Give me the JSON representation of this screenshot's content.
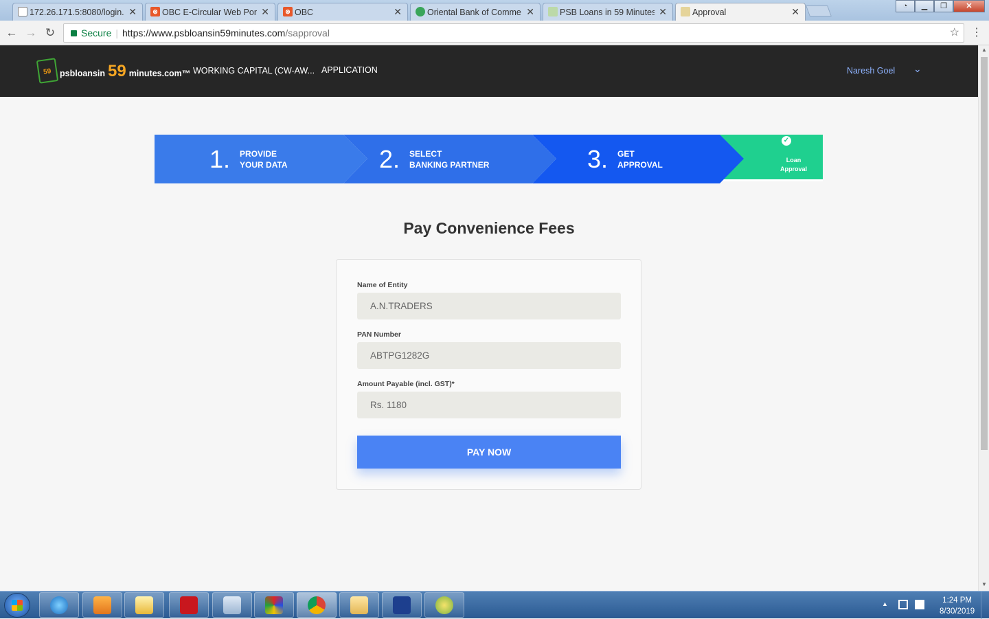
{
  "browser": {
    "tabs": [
      {
        "label": "172.26.171.5:8080/login.",
        "icon": "page-icon",
        "active": false
      },
      {
        "label": "OBC E-Circular Web Port",
        "icon": "obc-icon",
        "active": false
      },
      {
        "label": "OBC",
        "icon": "obc-icon",
        "active": false
      },
      {
        "label": "Oriental Bank of Comme",
        "icon": "obc-bank-icon",
        "active": false
      },
      {
        "label": "PSB Loans in 59 Minutes",
        "icon": "psb-icon",
        "active": false
      },
      {
        "label": "Approval",
        "icon": "psb-icon",
        "active": true
      }
    ],
    "close_glyph": "✕",
    "secure_label": "Secure",
    "url_host": "https://www.psbloansin59minutes.com",
    "url_path": "/sapproval"
  },
  "header": {
    "logo_prefix": "psbloansin",
    "logo_number": "59",
    "logo_suffix": "minutes.com™",
    "logo_badge": "59",
    "product": "WORKING CAPITAL (CW-AW...",
    "nav_application": "APPLICATION",
    "user_name": "Naresh Goel"
  },
  "steps": [
    {
      "number": "1.",
      "line1": "PROVIDE",
      "line2": "YOUR DATA"
    },
    {
      "number": "2.",
      "line1": "SELECT",
      "line2": "BANKING PARTNER"
    },
    {
      "number": "3.",
      "line1": "GET",
      "line2": "APPROVAL"
    },
    {
      "line1": "Loan",
      "line2": "Approval",
      "status": "complete"
    }
  ],
  "form": {
    "title": "Pay Convenience Fees",
    "entity_label": "Name of Entity",
    "entity_value": "A.N.TRADERS",
    "pan_label": "PAN Number",
    "pan_value": "ABTPG1282G",
    "amount_label": "Amount Payable (incl. GST)*",
    "amount_value": "Rs. 1180",
    "pay_button": "PAY NOW"
  },
  "taskbar": {
    "time": "1:24 PM",
    "date": "8/30/2019",
    "apps": [
      "ie-icon",
      "media-player-icon",
      "outlook-icon",
      "acrobat-icon",
      "notepad-icon",
      "paint-icon",
      "chrome-icon",
      "explorer-icon",
      "iw-icon",
      "psb-app-icon"
    ]
  },
  "colors": {
    "header_bg": "#262626",
    "step_blue": "#3a7bea",
    "step_complete": "#1fd08f",
    "pay_button": "#4a83f4"
  }
}
